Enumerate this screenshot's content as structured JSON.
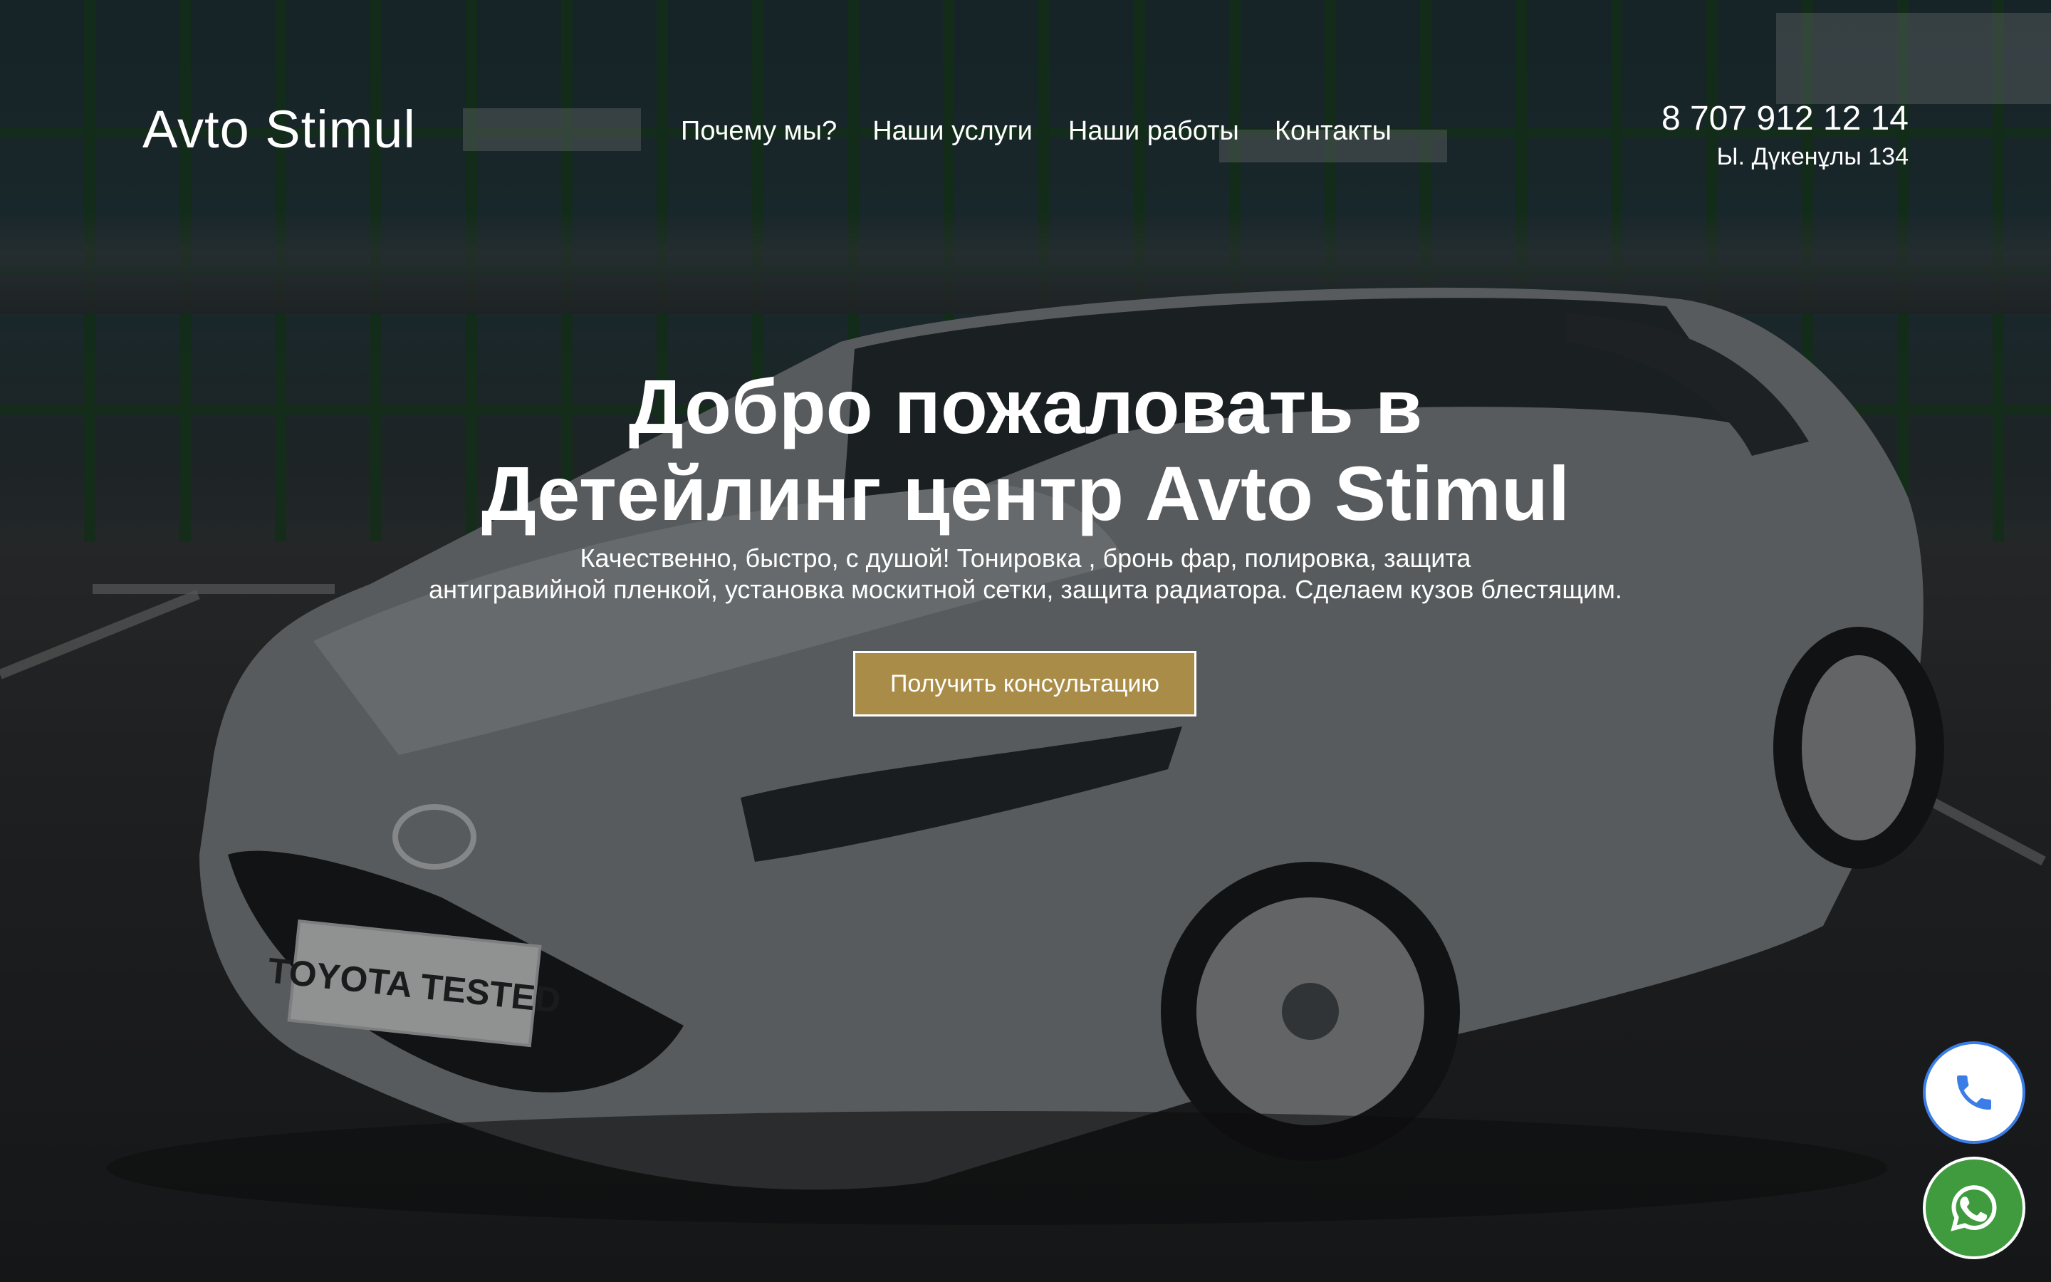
{
  "header": {
    "logo": "Avto Stimul",
    "nav": [
      {
        "label": "Почему мы?"
      },
      {
        "label": "Наши услуги"
      },
      {
        "label": "Наши работы"
      },
      {
        "label": "Контакты"
      }
    ],
    "phone": "8 707 912 12 14",
    "address": "Ы. Дүкенұлы 134"
  },
  "hero": {
    "title_line1": "Добро пожаловать в",
    "title_line2": "Детейлинг центр Avto Stimul",
    "subtitle_line1": "Качественно, быстро, с душой! Тонировка , бронь фар, полировка, защита",
    "subtitle_line2": "антигравийной пленкой, установка москитной сетки, защита радиатора. Сделаем кузов блестящим.",
    "cta_label": "Получить консультацию",
    "background_image": "Toyota Camry in parking lot",
    "license_plate": "TOYOTA TESTED"
  },
  "floating": {
    "call_icon": "phone-icon",
    "whatsapp_icon": "whatsapp-icon"
  },
  "colors": {
    "accent": "#a98c47",
    "call_border": "#3b7de6",
    "whatsapp": "#3f9b3e"
  }
}
